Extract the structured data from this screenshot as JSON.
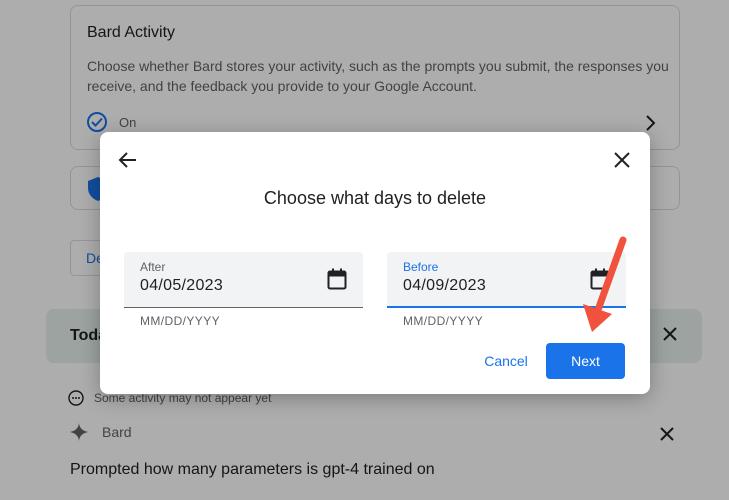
{
  "background": {
    "activity_card": {
      "title": "Bard Activity",
      "description": "Choose whether Bard stores your activity, such as the prompts you submit, the responses you receive, and the feedback you provide to your Google Account.",
      "status": "On"
    },
    "delete_button_label": "De",
    "today_label": "Toda",
    "note": "Some activity may not appear yet",
    "bard_label": "Bard",
    "prompt_text": "Prompted how many parameters is gpt-4 trained on"
  },
  "dialog": {
    "title": "Choose what days to delete",
    "after_field": {
      "label": "After",
      "value": "04/05/2023",
      "hint": "MM/DD/YYYY"
    },
    "before_field": {
      "label": "Before",
      "value": "04/09/2023",
      "hint": "MM/DD/YYYY"
    },
    "cancel_label": "Cancel",
    "next_label": "Next"
  },
  "colors": {
    "accent": "#1a73e8",
    "annotation_arrow": "#f0523d",
    "today_bar": "#e6f0ec"
  },
  "icons": {
    "back": "arrow-left-icon",
    "close": "close-icon",
    "calendar": "calendar-icon",
    "check": "check-circle-icon",
    "shield": "shield-icon",
    "sparkle": "sparkle-icon"
  }
}
